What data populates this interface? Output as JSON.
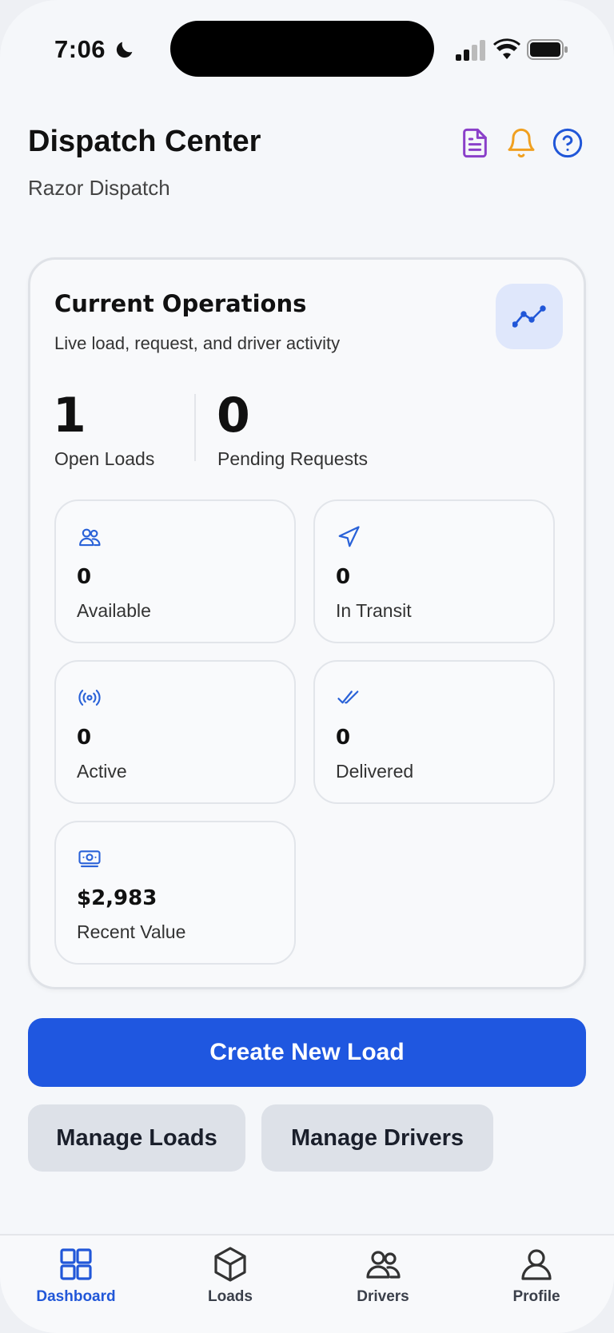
{
  "status_bar": {
    "time": "7:06"
  },
  "header": {
    "title": "Dispatch Center",
    "subtitle": "Razor Dispatch",
    "icons": [
      "document-icon",
      "bell-icon",
      "help-icon"
    ]
  },
  "operations": {
    "title": "Current Operations",
    "subtitle": "Live load, request, and driver activity",
    "open_loads": {
      "value": "1",
      "label": "Open Loads"
    },
    "pending_requests": {
      "value": "0",
      "label": "Pending Requests"
    },
    "tiles": [
      {
        "icon": "users-icon",
        "value": "0",
        "label": "Available"
      },
      {
        "icon": "navigation-icon",
        "value": "0",
        "label": "In Transit"
      },
      {
        "icon": "broadcast-icon",
        "value": "0",
        "label": "Active"
      },
      {
        "icon": "double-check-icon",
        "value": "0",
        "label": "Delivered"
      },
      {
        "icon": "cash-icon",
        "value": "$2,983",
        "label": "Recent Value"
      }
    ]
  },
  "actions": {
    "create_load": "Create New Load",
    "manage_loads": "Manage Loads",
    "manage_drivers": "Manage Drivers"
  },
  "tabs": [
    {
      "label": "Dashboard",
      "icon": "grid-icon",
      "active": true
    },
    {
      "label": "Loads",
      "icon": "box-icon",
      "active": false
    },
    {
      "label": "Drivers",
      "icon": "users-icon",
      "active": false
    },
    {
      "label": "Profile",
      "icon": "user-icon",
      "active": false
    }
  ],
  "colors": {
    "accent": "#1f57e0",
    "document_icon": "#8a3fc9",
    "bell_icon": "#f0a020",
    "help_icon": "#2157d8"
  }
}
